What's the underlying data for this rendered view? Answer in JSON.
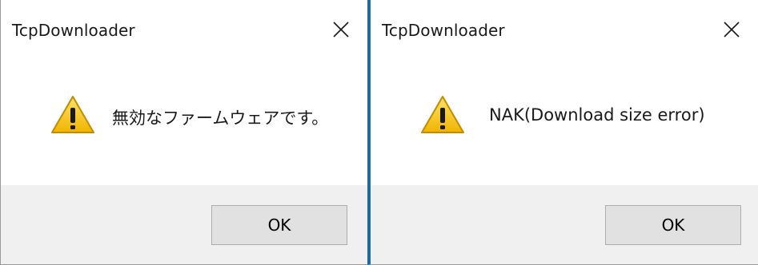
{
  "dialogs": [
    {
      "title": "TcpDownloader",
      "message": "無効なファームウェアです。",
      "ok_label": "OK",
      "icon": "warning-icon",
      "close_icon": "close-icon"
    },
    {
      "title": "TcpDownloader",
      "message": "NAK(Download size error)",
      "ok_label": "OK",
      "icon": "warning-icon",
      "close_icon": "close-icon"
    }
  ],
  "colors": {
    "window_accent": "#1c6aa5",
    "footer_bg": "#f0f0f0",
    "button_bg": "#e1e1e1",
    "button_border": "#adadad",
    "warning_yellow": "#f5c518"
  }
}
